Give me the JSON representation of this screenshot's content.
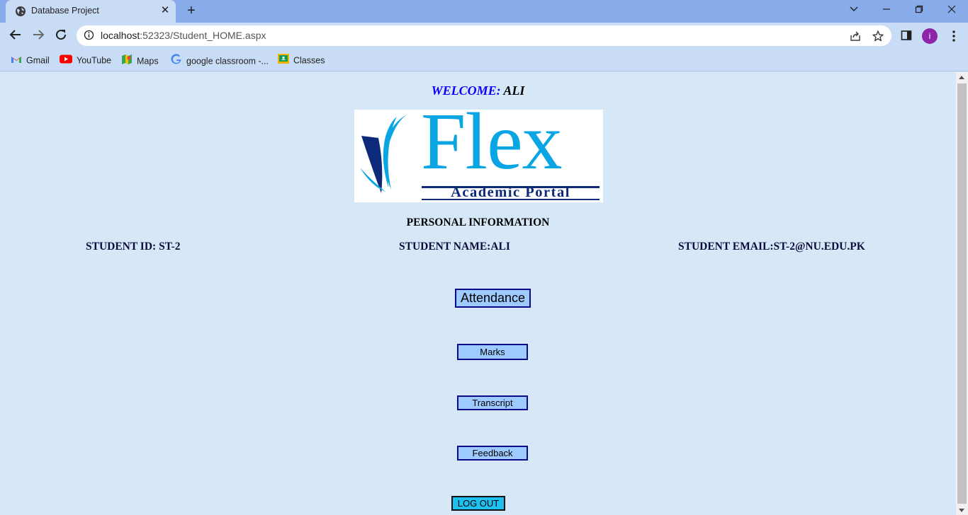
{
  "browser": {
    "tab_title": "Database Project",
    "url_host": "localhost",
    "url_rest": ":52323/Student_HOME.aspx",
    "avatar_letter": "i",
    "bookmarks": [
      "Gmail",
      "YouTube",
      "Maps",
      "google classroom -...",
      "Classes"
    ]
  },
  "page": {
    "welcome_label": "WELCOME:",
    "welcome_name": " ALI",
    "logo_word": "Flex",
    "logo_sub": "Academic Portal",
    "section_title": "PERSONAL INFORMATION",
    "student_id": "STUDENT ID: ST-2",
    "student_name": "STUDENT NAME:ALI",
    "student_email": "STUDENT EMAIL:ST-2@NU.EDU.PK",
    "buttons": {
      "attendance": "Attendance",
      "marks": "Marks",
      "transcript": "Transcript",
      "feedback": "Feedback",
      "logout": "LOG OUT"
    }
  },
  "colors": {
    "page_bg": "#d6e8f7",
    "welcome_label": "#0b00ff",
    "logo_blue": "#0aa5e3",
    "logo_navy": "#0d2a7a",
    "button_bg": "#9ecbff",
    "logout_bg": "#1ec0f0"
  },
  "icons": {
    "tab": "globe-icon",
    "nav": [
      "back-arrow-icon",
      "forward-arrow-icon",
      "reload-icon"
    ],
    "omnibox": [
      "info-icon",
      "share-icon",
      "star-icon"
    ],
    "toolbar": [
      "side-panel-icon",
      "kebab-menu-icon"
    ]
  }
}
